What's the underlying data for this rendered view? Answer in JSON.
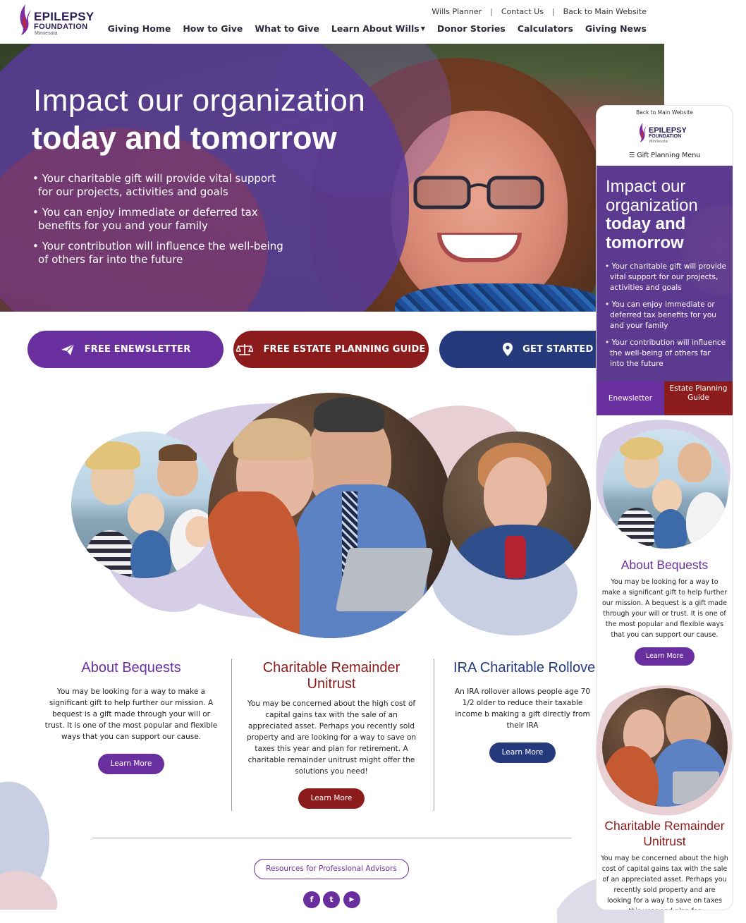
{
  "header": {
    "logo": {
      "line1": "EPILEPSY",
      "line2": "FOUNDATION",
      "line3": "Minnesota"
    },
    "utility_links": [
      "Wills Planner",
      "Contact Us",
      "Back to Main Website"
    ],
    "nav": [
      {
        "label": "Giving Home"
      },
      {
        "label": "How to Give"
      },
      {
        "label": "What to Give"
      },
      {
        "label": "Learn About Wills",
        "has_dropdown": true
      },
      {
        "label": "Donor Stories"
      },
      {
        "label": "Calculators"
      },
      {
        "label": "Giving News"
      }
    ]
  },
  "hero": {
    "title_light": "Impact our organization",
    "title_bold": "today and tomorrow",
    "bullets": [
      "Your charitable gift will provide vital support for our projects, activities and goals",
      "You can enjoy immediate or deferred tax benefits for you and your family",
      "Your contribution will influence the well-being of others far into the future"
    ]
  },
  "cta": {
    "newsletter": "FREE ENEWSLETTER",
    "estate": "FREE ESTATE PLANNING GUIDE",
    "start": "GET STARTED"
  },
  "features": [
    {
      "title": "About Bequests",
      "text": "You may be looking for a way to make a significant gift to help further our mission. A bequest is a gift made through your will or trust. It is one of the most popular and flexible ways that you can support our cause.",
      "button": "Learn More",
      "color": "#6a2f9e"
    },
    {
      "title": "Charitable Remainder Unitrust",
      "text": "You may be concerned about the high cost of capital gains tax with the sale of an appreciated asset. Perhaps you recently sold property and are looking for a way to save on taxes this year and plan for retirement. A charitable remainder unitrust might offer the solutions you need!",
      "button": "Learn More",
      "color": "#8c1b1b"
    },
    {
      "title": "IRA Charitable Rollove",
      "text": "An IRA rollover allows people age 70 1/2 older to reduce their taxable income b making a gift directly from their IRA",
      "button": "Learn More",
      "color": "#243a7c"
    }
  ],
  "footer": {
    "advisors": "Resources for Professional Advisors",
    "social": [
      {
        "icon": "facebook-icon",
        "glyph": "f"
      },
      {
        "icon": "twitter-icon",
        "glyph": "t"
      },
      {
        "icon": "youtube-icon",
        "glyph": "▶"
      }
    ]
  },
  "mobile": {
    "back_link": "Back to Main Website",
    "logo": {
      "line1": "EPILEPSY",
      "line2": "FOUNDATION",
      "line3": "Minnesota"
    },
    "menu_label": "Gift Planning Menu",
    "hero_title_light": "Impact our organization",
    "hero_title_bold": "today and tomorrow",
    "bullets": [
      "Your charitable gift will provide vital support for our projects, activities and goals",
      "You can enjoy immediate or deferred tax benefits for you and your family",
      "Your contribution will influence the well-being of others far into the future"
    ],
    "tab_newsletter": "Enewsletter",
    "tab_estate": "Estate Planning Guide",
    "bequests_title": "About Bequests",
    "bequests_text": "You may be looking for a way to make a significant gift to help further our mission. A bequest is a gift made through your will or trust. It is one of the most popular and flexible ways that you can support our cause.",
    "bequests_button": "Learn More",
    "crut_title": "Charitable Remainder Unitrust",
    "crut_text": "You may be concerned about the high cost of capital gains tax with the sale of an appreciated asset. Perhaps you recently sold property and are looking for a way to save on taxes this year and plan for"
  },
  "colors": {
    "purple": "#6a2f9e",
    "red": "#8c1b1b",
    "navy": "#243a7c",
    "brand_dark": "#2b1b57"
  }
}
